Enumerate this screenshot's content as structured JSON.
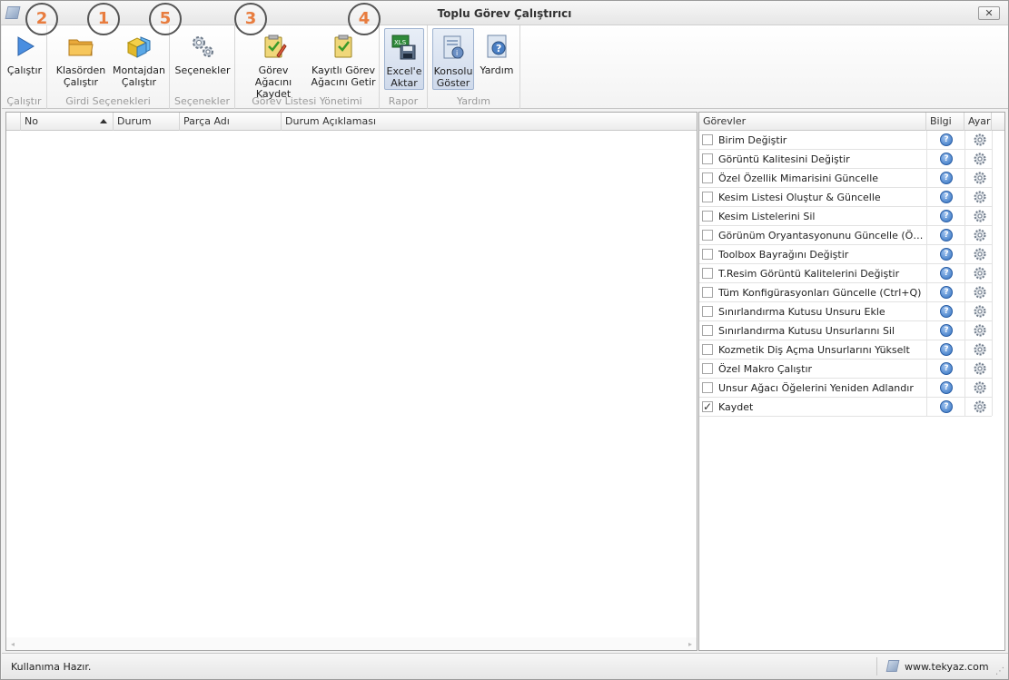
{
  "window": {
    "title": "Toplu Görev Çalıştırıcı",
    "close_label": "✕"
  },
  "ribbon": {
    "groups": [
      {
        "label": "Çalıştır",
        "buttons": [
          {
            "label": "Çalıştır",
            "icon": "play-icon"
          }
        ]
      },
      {
        "label": "Girdi Seçenekleri",
        "buttons": [
          {
            "label": "Klasörden\nÇalıştır",
            "icon": "folder-icon"
          },
          {
            "label": "Montajdan\nÇalıştır",
            "icon": "assembly-icon"
          }
        ]
      },
      {
        "label": "Seçenekler",
        "buttons": [
          {
            "label": "Seçenekler",
            "icon": "gears-icon"
          }
        ]
      },
      {
        "label": "Görev Listesi Yönetimi",
        "buttons": [
          {
            "label": "Görev Ağacını\nKaydet",
            "icon": "save-tree-icon"
          },
          {
            "label": "Kayıtlı Görev\nAğacını Getir",
            "icon": "load-tree-icon"
          }
        ]
      },
      {
        "label": "Rapor",
        "buttons": [
          {
            "label": "Excel'e\nAktar",
            "icon": "excel-export-icon"
          }
        ]
      },
      {
        "label": "Yardım",
        "buttons": [
          {
            "label": "Konsolu\nGöster",
            "icon": "console-icon"
          },
          {
            "label": "Yardım",
            "icon": "help-icon"
          }
        ]
      }
    ],
    "callouts": [
      "2",
      "1",
      "5",
      "3",
      "4"
    ]
  },
  "grid": {
    "columns": [
      "No",
      "Durum",
      "Parça Adı",
      "Durum Açıklaması"
    ],
    "rows": []
  },
  "tasks": {
    "header": {
      "name": "Görevler",
      "info": "Bilgi",
      "settings": "Ayar"
    },
    "items": [
      {
        "name": "Birim Değiştir",
        "checked": false
      },
      {
        "name": "Görüntü Kalitesini Değiştir",
        "checked": false
      },
      {
        "name": "Özel Özellik Mimarisini Güncelle",
        "checked": false
      },
      {
        "name": "Kesim Listesi Oluştur & Güncelle",
        "checked": false
      },
      {
        "name": "Kesim Listelerini Sil",
        "checked": false
      },
      {
        "name": "Görünüm Oryantasyonunu Güncelle (Ön, Sağ...",
        "checked": false
      },
      {
        "name": "Toolbox Bayrağını Değiştir",
        "checked": false
      },
      {
        "name": "T.Resim Görüntü Kalitelerini Değiştir",
        "checked": false
      },
      {
        "name": "Tüm Konfigürasyonları Güncelle (Ctrl+Q)",
        "checked": false
      },
      {
        "name": "Sınırlandırma Kutusu Unsuru Ekle",
        "checked": false
      },
      {
        "name": "Sınırlandırma Kutusu Unsurlarını Sil",
        "checked": false
      },
      {
        "name": "Kozmetik Diş Açma Unsurlarını Yükselt",
        "checked": false
      },
      {
        "name": "Özel Makro Çalıştır",
        "checked": false
      },
      {
        "name": "Unsur Ağacı Öğelerini Yeniden Adlandır",
        "checked": false
      },
      {
        "name": "Kaydet",
        "checked": true
      }
    ]
  },
  "status": {
    "message": "Kullanıma Hazır.",
    "website": "www.tekyaz.com"
  },
  "colors": {
    "accent": "#2f6fbf",
    "callout": "#e87c3e"
  }
}
